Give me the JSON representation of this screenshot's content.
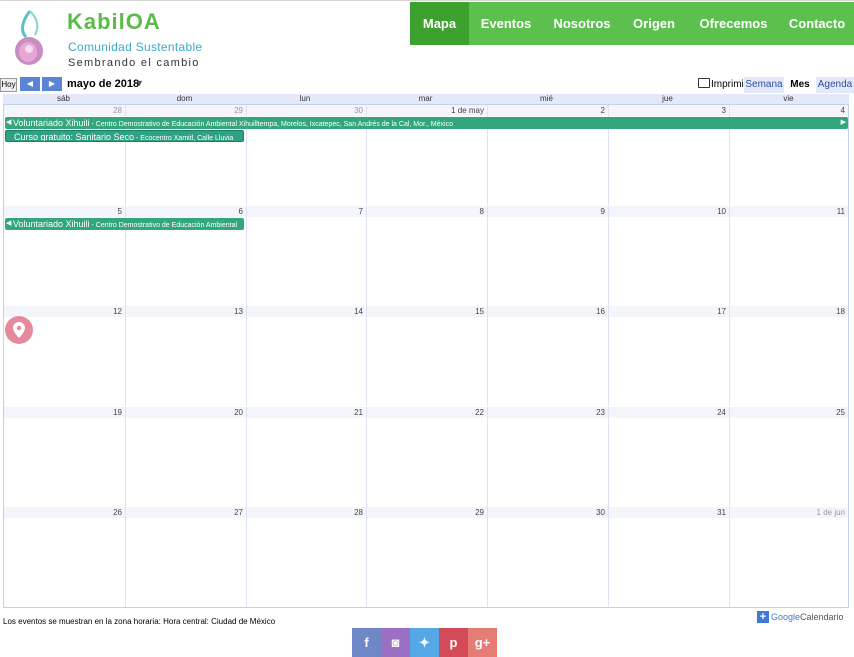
{
  "brand": {
    "title": "KabilOA",
    "subtitle": "Comunidad Sustentable",
    "tagline": "Sembrando el cambio",
    "logo_icon": "seedling-logo-icon",
    "colors": {
      "title": "#5bbb4a",
      "subtitle": "#3aa9c9"
    }
  },
  "nav": {
    "items": [
      "Mapa",
      "Eventos",
      "Nosotros",
      "Origen",
      "Ofrecemos",
      "Contacto"
    ],
    "active": "Mapa",
    "colors": {
      "background": "#5cc04f",
      "active": "#3ca12f"
    }
  },
  "calendar": {
    "today_label": "Hoy",
    "prev_icon": "◀",
    "next_icon": "▶",
    "month_label": "mayo de 2018",
    "caret": "▼",
    "print_label": "Imprimir",
    "view_tabs": [
      "Semana",
      "Mes",
      "Agenda"
    ],
    "active_view": "Mes",
    "weekdays": [
      "sáb",
      "dom",
      "lun",
      "mar",
      "mié",
      "jue",
      "vie"
    ],
    "weeks": [
      [
        "28",
        "29",
        "30",
        "1 de may",
        "2",
        "3",
        "4"
      ],
      [
        "5",
        "6",
        "7",
        "8",
        "9",
        "10",
        "11"
      ],
      [
        "12",
        "13",
        "14",
        "15",
        "16",
        "17",
        "18"
      ],
      [
        "19",
        "20",
        "21",
        "22",
        "23",
        "24",
        "25"
      ],
      [
        "26",
        "27",
        "28",
        "29",
        "30",
        "31",
        "1 de jun"
      ]
    ],
    "outside_month": [
      [
        0,
        0
      ],
      [
        0,
        1
      ],
      [
        0,
        2
      ],
      [
        4,
        6
      ]
    ],
    "events": {
      "e1": {
        "title": "Voluntariado Xihuili",
        "location": " - Centro Demostrativo de Educación Ambiental Xihuilltempa, Morelos, Ixcatepec, San Andrés de la Cal, Mor., México"
      },
      "e2": {
        "title": "Curso gratuito: Sanitario Seco",
        "location": " - Ecocentro Xamitl, Calle Lluvia"
      },
      "e3": {
        "title": "Voluntariado Xihuili",
        "location": " - Centro Demostrativo de Educación Ambiental"
      }
    },
    "event_color": "#33a67e",
    "timezone_note": "Los eventos se muestran en la zona horaria: Hora central: Ciudad de México",
    "gcal_google": "Google",
    "gcal_label": "Calendario"
  },
  "map_pin_icon": "map-pin-icon",
  "social": [
    {
      "name": "facebook",
      "glyph": "f",
      "color": "#6f87c6"
    },
    {
      "name": "instagram",
      "glyph": "◙",
      "color": "#9a6fc4"
    },
    {
      "name": "twitter",
      "glyph": "✦",
      "color": "#55a8e6"
    },
    {
      "name": "pinterest",
      "glyph": "p",
      "color": "#d54a58"
    },
    {
      "name": "google-plus",
      "glyph": "g+",
      "color": "#e67d74"
    }
  ]
}
